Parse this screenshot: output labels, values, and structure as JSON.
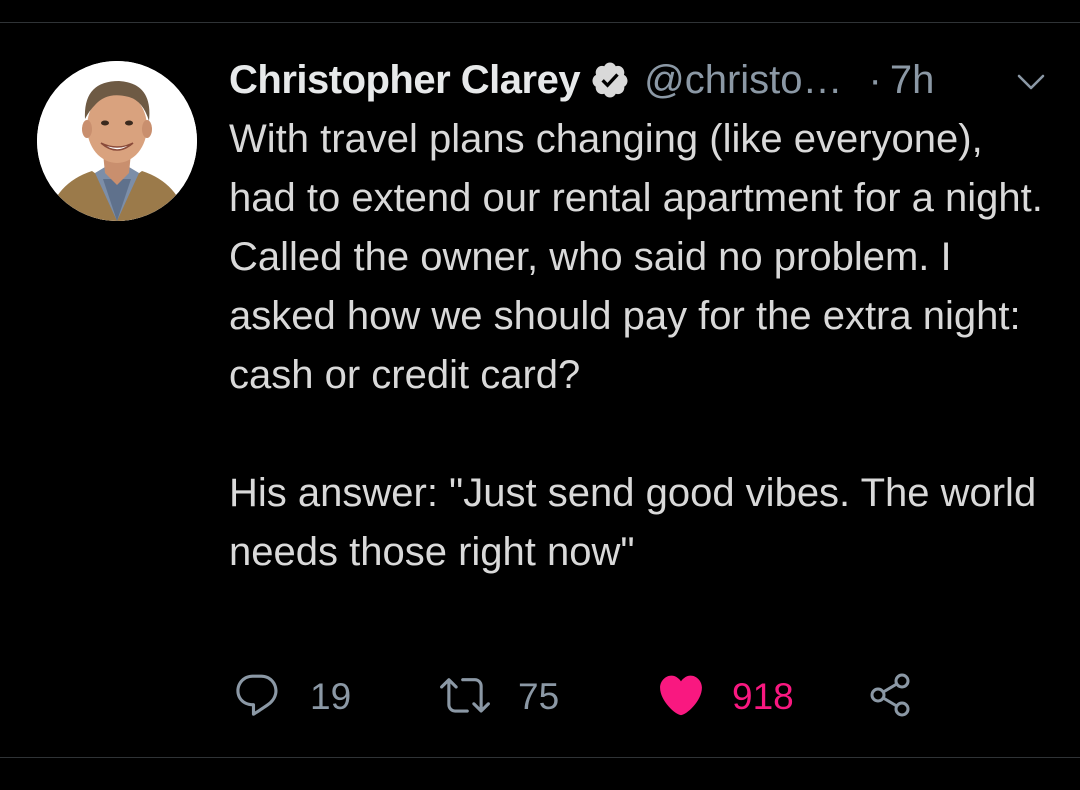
{
  "tweet": {
    "author_name": "Christopher Clarey",
    "handle": "@christo…",
    "separator": "·",
    "time": "7h",
    "verified": true,
    "text_paragraph_1": "With travel plans changing (like everyone), had to extend our rental apartment for a night. Called the owner, who said no problem. I asked how we should pay for the extra night: cash or credit card?",
    "text_paragraph_2": "His answer: \"Just send good vibes. The world needs those right now\""
  },
  "actions": {
    "reply_count": "19",
    "retweet_count": "75",
    "like_count": "918"
  },
  "icons": {
    "avatar": "profile-photo",
    "verified": "verified-badge-icon",
    "more": "chevron-down-icon",
    "reply": "comment-bubble-icon",
    "retweet": "retweet-icon",
    "like": "heart-icon",
    "share": "share-icon"
  },
  "colors": {
    "background": "#000000",
    "text": "#d9d9d9",
    "secondary": "#8b98a5",
    "like": "#f91880"
  }
}
